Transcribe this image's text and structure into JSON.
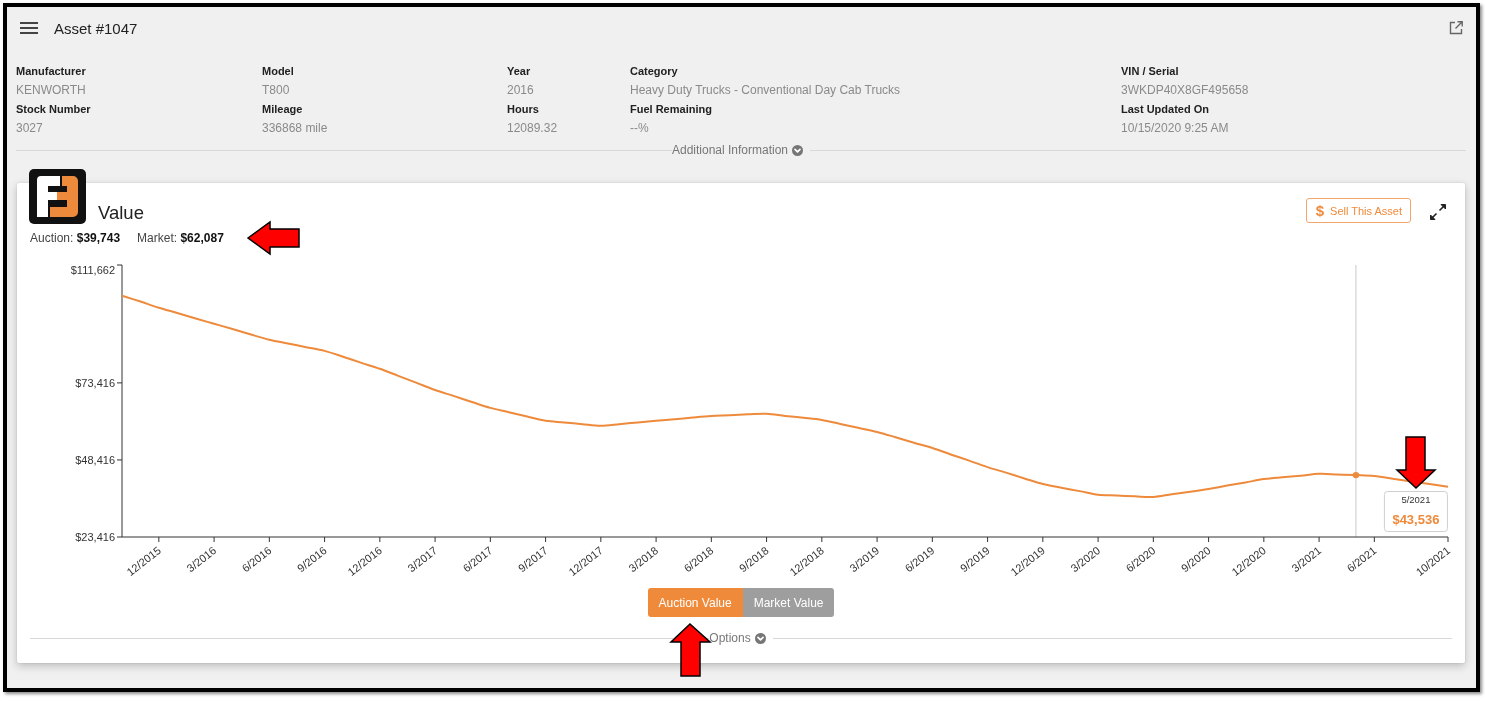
{
  "window": {
    "title": "Asset #1047"
  },
  "details": [
    {
      "label": "Manufacturer",
      "value": "KENWORTH"
    },
    {
      "label": "Model",
      "value": "T800"
    },
    {
      "label": "Year",
      "value": "2016"
    },
    {
      "label": "Category",
      "value": "Heavy Duty Trucks - Conventional Day Cab Trucks"
    },
    {
      "label": "VIN / Serial",
      "value": "3WKDP40X8GF495658"
    },
    {
      "label": "Stock Number",
      "value": "3027"
    },
    {
      "label": "Mileage",
      "value": "336868 mile"
    },
    {
      "label": "Hours",
      "value": "12089.32"
    },
    {
      "label": "Fuel Remaining",
      "value": "--%"
    },
    {
      "label": "Last Updated On",
      "value": "10/15/2020 9:25 AM"
    }
  ],
  "additional_info": {
    "label": "Additional Information",
    "expanded": false
  },
  "value_card": {
    "title": "Value",
    "summary": [
      "Auction: **$39,743**",
      "Market: **$62,087**"
    ],
    "sell_button": {
      "icon": "$",
      "label": "Sell This Asset"
    },
    "chart_data": {
      "type": "line",
      "categories": [
        null,
        null,
        "12/2015",
        null,
        null,
        "3/2016",
        null,
        null,
        "6/2016",
        null,
        null,
        "9/2016",
        null,
        null,
        "12/2016",
        null,
        null,
        "3/2017",
        null,
        null,
        "6/2017",
        null,
        null,
        "9/2017",
        null,
        null,
        "12/2017",
        null,
        null,
        "3/2018",
        null,
        null,
        "6/2018",
        null,
        null,
        "9/2018",
        null,
        null,
        "12/2018",
        null,
        null,
        "3/2019",
        null,
        null,
        "6/2019",
        null,
        null,
        "9/2019",
        null,
        null,
        "12/2019",
        null,
        null,
        "3/2020",
        null,
        null,
        "6/2020",
        null,
        null,
        "9/2020",
        null,
        null,
        "12/2020",
        null,
        null,
        "3/2021",
        null,
        null,
        "6/2021",
        null,
        null,
        null,
        "10/2021"
      ],
      "series": [
        {
          "color": "#ee8a3b",
          "values": [
            101700,
            99800,
            97800,
            96100,
            94300,
            92600,
            90900,
            89100,
            87400,
            86200,
            85000,
            83800,
            81900,
            79900,
            78000,
            75700,
            73400,
            71100,
            69200,
            67200,
            65300,
            63900,
            62500,
            61100,
            60600,
            60000,
            59500,
            60000,
            60600,
            61100,
            61600,
            62200,
            62700,
            62900,
            63200,
            63400,
            62700,
            62100,
            61400,
            60100,
            58800,
            57500,
            55800,
            54000,
            52300,
            50200,
            48200,
            46100,
            44300,
            42400,
            40600,
            39400,
            38300,
            37100,
            36900,
            36600,
            36400,
            37300,
            38100,
            39000,
            40100,
            41100,
            42200,
            42800,
            43300,
            43900,
            43700,
            43500,
            43200,
            42300,
            null,
            40600,
            39700
          ]
        },
        {
          "color": "#ee8a3b",
          "marker": "circle",
          "values": [
            null,
            null,
            null,
            null,
            null,
            null,
            null,
            null,
            null,
            null,
            null,
            null,
            null,
            null,
            null,
            null,
            null,
            null,
            null,
            null,
            null,
            null,
            null,
            null,
            null,
            null,
            null,
            null,
            null,
            null,
            null,
            null,
            null,
            null,
            null,
            null,
            null,
            null,
            null,
            null,
            null,
            null,
            null,
            null,
            null,
            null,
            null,
            null,
            null,
            null,
            null,
            null,
            null,
            null,
            null,
            null,
            null,
            null,
            null,
            null,
            null,
            null,
            null,
            null,
            null,
            null,
            null,
            43500,
            null,
            null,
            null,
            null,
            null
          ]
        }
      ],
      "ylim": [
        23416,
        111662
      ],
      "yticks": [
        {
          "value": 23416,
          "label": "$23,416"
        },
        {
          "value": 48416,
          "label": "$48,416"
        },
        {
          "value": 73416,
          "label": "$73,416"
        },
        {
          "value": 111662,
          "label": "$111,662"
        }
      ]
    },
    "tooltip": {
      "title": "5/2021",
      "value": "$43,536"
    },
    "series_toggle": [
      {
        "label": "Auction Value",
        "selected": true
      },
      {
        "label": "Market Value",
        "selected": false
      }
    ],
    "options": {
      "label": "Options",
      "expanded": false
    }
  }
}
